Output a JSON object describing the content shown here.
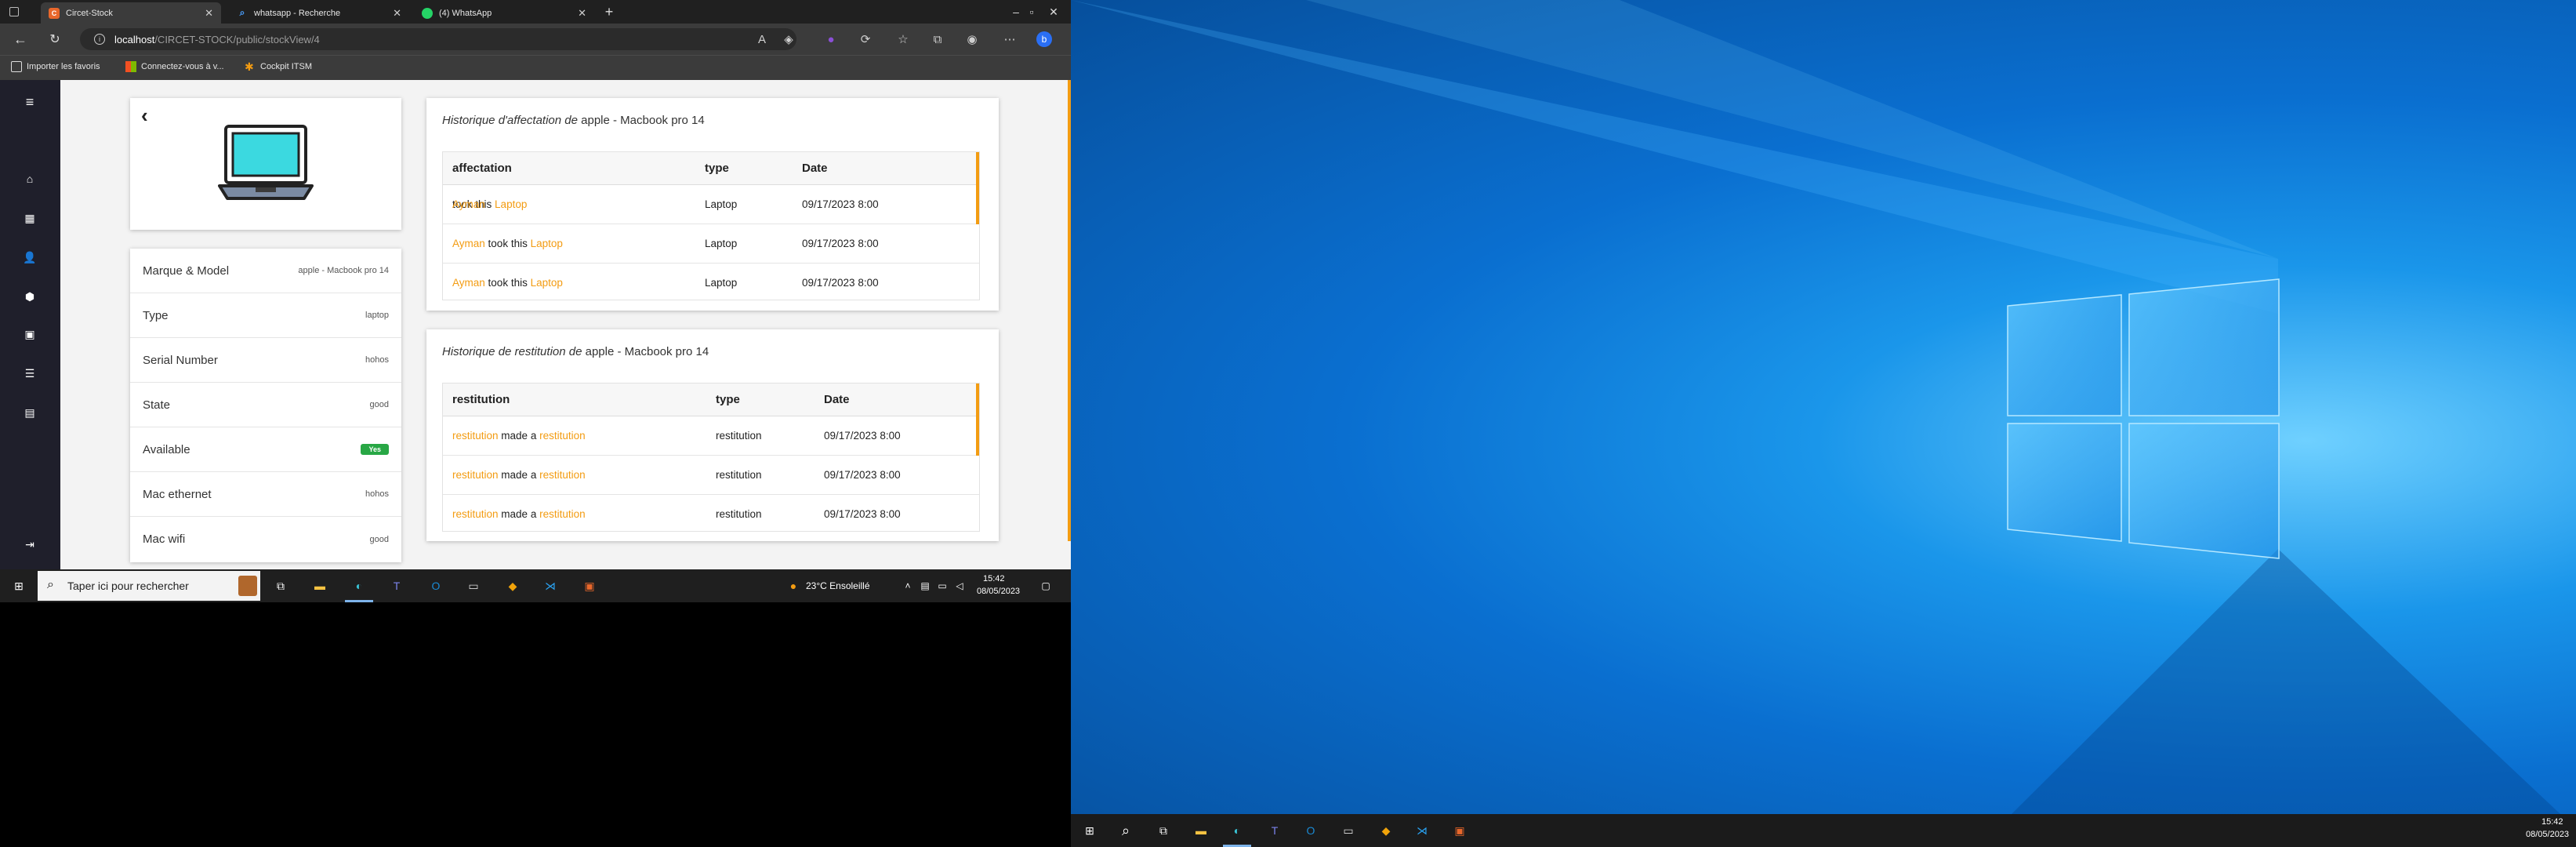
{
  "browser": {
    "tabs": [
      {
        "label": "Circet-Stock",
        "active": true
      },
      {
        "label": "whatsapp - Recherche",
        "active": false
      },
      {
        "label": "(4) WhatsApp",
        "active": false
      }
    ],
    "url_host": "localhost",
    "url_path": "/CIRCET-STOCK/public/stockView/4",
    "favorites": [
      "Importer les favoris",
      "Connectez-vous à v...",
      "Cockpit ITSM"
    ]
  },
  "details": [
    {
      "label": "Marque & Model",
      "value": "apple - Macbook pro 14"
    },
    {
      "label": "Type",
      "value": "laptop"
    },
    {
      "label": "Serial Number",
      "value": "hohos"
    },
    {
      "label": "State",
      "value": "good"
    },
    {
      "label": "Available",
      "value": "Yes"
    },
    {
      "label": "Mac ethernet",
      "value": "hohos"
    },
    {
      "label": "Mac wifi",
      "value": "good"
    }
  ],
  "affectation": {
    "title_italic": "Historique d'affectation de",
    "title_item": "apple - Macbook pro 14",
    "headers": [
      "affectation",
      "type",
      "Date"
    ],
    "rows": [
      {
        "user": "Ayman",
        "verb": "took this",
        "object": "Laptop",
        "type": "Laptop",
        "date": "09/17/2023 8:00"
      },
      {
        "user": "Ayman",
        "verb": "took this",
        "object": "Laptop",
        "type": "Laptop",
        "date": "09/17/2023 8:00"
      },
      {
        "user": "Ayman",
        "verb": "took this",
        "object": "Laptop",
        "type": "Laptop",
        "date": "09/17/2023 8:00"
      }
    ]
  },
  "restitution": {
    "title_italic": "Historique de restitution de",
    "title_item": "apple - Macbook pro 14",
    "headers": [
      "restitution",
      "type",
      "Date"
    ],
    "rows": [
      {
        "user": "restitution",
        "verb": "made a",
        "object": "restitution",
        "type": "restitution",
        "date": "09/17/2023 8:00"
      },
      {
        "user": "restitution",
        "verb": "made a",
        "object": "restitution",
        "type": "restitution",
        "date": "09/17/2023 8:00"
      },
      {
        "user": "restitution",
        "verb": "made a",
        "object": "restitution",
        "type": "restitution",
        "date": "09/17/2023 8:00"
      }
    ]
  },
  "taskbar_left": {
    "search_placeholder": "Taper ici pour rechercher",
    "weather": "23°C  Ensoleillé",
    "time": "15:42",
    "date": "08/05/2023",
    "notification_count": "1"
  },
  "taskbar_right": {
    "time": "15:42",
    "date": "08/05/2023"
  },
  "colors": {
    "accent": "#f39c12",
    "sidebar": "#1f1f2b",
    "available_badge": "#28a745",
    "desktop_blue": "#0a6fd0"
  }
}
